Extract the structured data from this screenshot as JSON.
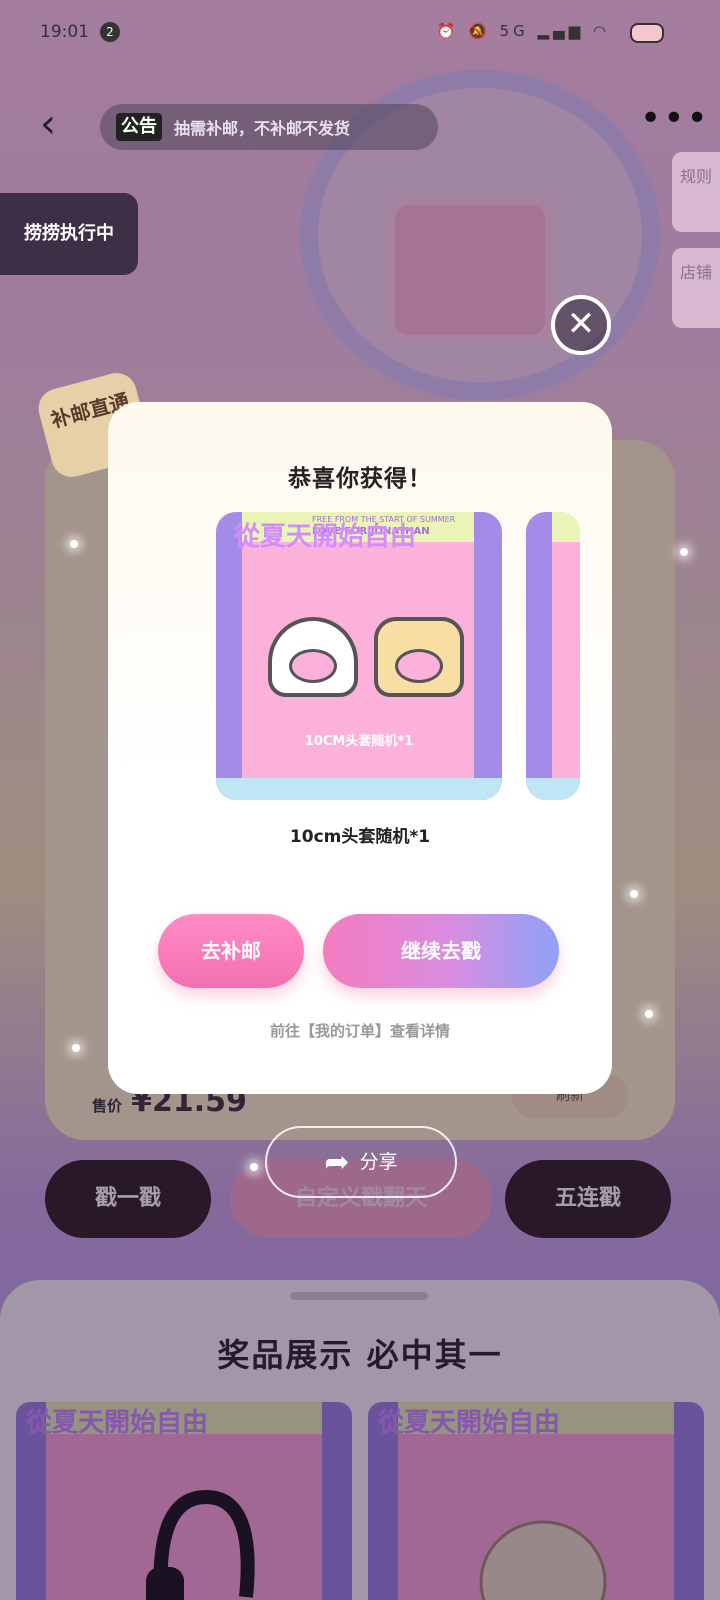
{
  "status_bar": {
    "time": "19:01",
    "notification_count": "2",
    "network": "5G"
  },
  "header": {
    "notice_tag": "公告",
    "notice_text": "抽需补邮，不补邮不发货"
  },
  "side_tabs": {
    "rules": "规则",
    "store": "店铺"
  },
  "running_badge": "捞捞执行中",
  "ship_badge": "补邮直通",
  "price": {
    "label": "售价",
    "value": "¥21.59"
  },
  "refresh_label": "刷新",
  "actions": {
    "single": "戳一戳",
    "custom": "自定义戳翻天",
    "five": "五连戳"
  },
  "share_label": "分享",
  "prize_section": {
    "title": "奖品展示 必中其一"
  },
  "modal": {
    "title": "恭喜你获得！",
    "card_brand": "從夏天開始自由",
    "card_top_line1": "FREE FROM THE START OF SUMMER",
    "card_top_line2": "LOVE FOR JONATHAN",
    "card_caption": "10CM头套随机*1",
    "reward_name": "10cm头套随机*1",
    "reship_button": "去补邮",
    "continue_button": "继续去戳",
    "orders_link": "前往【我的订单】查看详情"
  }
}
